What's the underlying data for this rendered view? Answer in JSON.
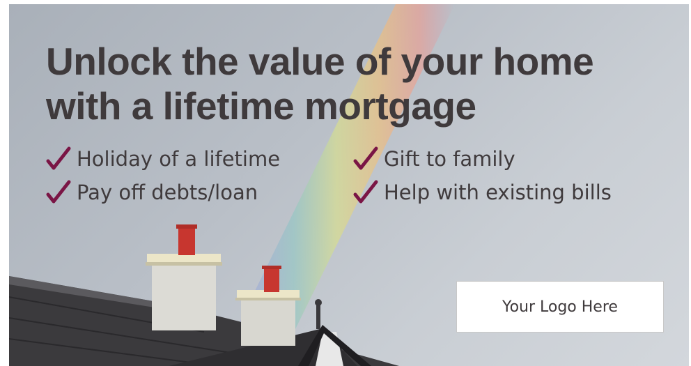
{
  "headline": {
    "line1": "Unlock the value of your home",
    "line2": "with a lifetime mortgage"
  },
  "benefits": [
    {
      "label": "Holiday of a lifetime"
    },
    {
      "label": "Gift to family"
    },
    {
      "label": "Pay off debts/loan"
    },
    {
      "label": "Help with existing bills"
    }
  ],
  "logo": {
    "label": "Your Logo Here"
  },
  "colors": {
    "headline_text": "#3f3a3c",
    "benefit_text": "#3f3a3c",
    "check_mark": "#7a1545",
    "logo_text": "#3f3a3c"
  },
  "icons": {
    "check": "check-mark-icon"
  }
}
